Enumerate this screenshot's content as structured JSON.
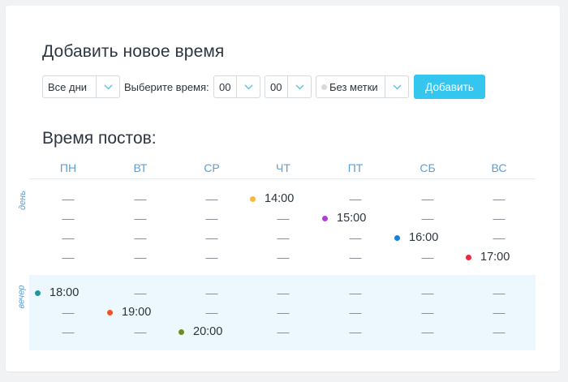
{
  "add_form": {
    "title": "Добавить новое время",
    "days_select": "Все дни",
    "time_label": "Выберите время:",
    "hour_select": "00",
    "minute_select": "00",
    "tag_select": "Без метки",
    "add_button": "Добавить"
  },
  "schedule": {
    "title": "Время постов:",
    "days": [
      "ПН",
      "ВТ",
      "СР",
      "ЧТ",
      "ПТ",
      "СБ",
      "ВС"
    ],
    "sections": {
      "day": "день",
      "evening": "вечер"
    },
    "slots": [
      {
        "day": "ЧТ",
        "time": "14:00",
        "color": "#f5b942"
      },
      {
        "day": "ПТ",
        "time": "15:00",
        "color": "#b33ddb"
      },
      {
        "day": "СБ",
        "time": "16:00",
        "color": "#1a7fd6"
      },
      {
        "day": "ВС",
        "time": "17:00",
        "color": "#e8283f"
      },
      {
        "day": "ПН",
        "time": "18:00",
        "color": "#1a9aa0"
      },
      {
        "day": "ВТ",
        "time": "19:00",
        "color": "#f0532a"
      },
      {
        "day": "СР",
        "time": "20:00",
        "color": "#6b8e23"
      }
    ]
  },
  "colors": {
    "accent": "#35c6ef",
    "day_header": "#5a9fd6",
    "evening_background": "#ecf8fd"
  }
}
